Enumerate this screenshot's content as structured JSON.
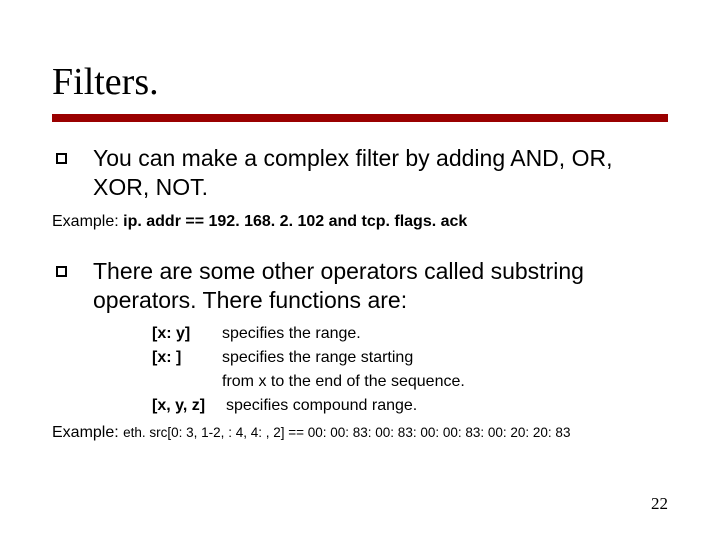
{
  "title": "Filters.",
  "bullet1": "You can make a complex filter by adding AND, OR, XOR, NOT.",
  "example1_label": "Example: ",
  "example1": "ip. addr == 192. 168. 2. 102 and tcp. flags. ack",
  "bullet2": "There are some other operators called substring operators. There functions are:",
  "ops": [
    {
      "key": "[x: y]",
      "desc": "specifies the range."
    },
    {
      "key": "[x: ]",
      "desc": "specifies the range starting"
    },
    {
      "key": "",
      "desc": "from x to the end of the sequence."
    },
    {
      "key": "[x, y, z]",
      "desc": "specifies compound range."
    }
  ],
  "example2_label": "Example: ",
  "example2": "eth. src[0: 3, 1-2, : 4, 4: , 2] == 00: 00: 83: 00: 83: 00: 00: 83: 00: 20: 20: 83",
  "page": "22"
}
